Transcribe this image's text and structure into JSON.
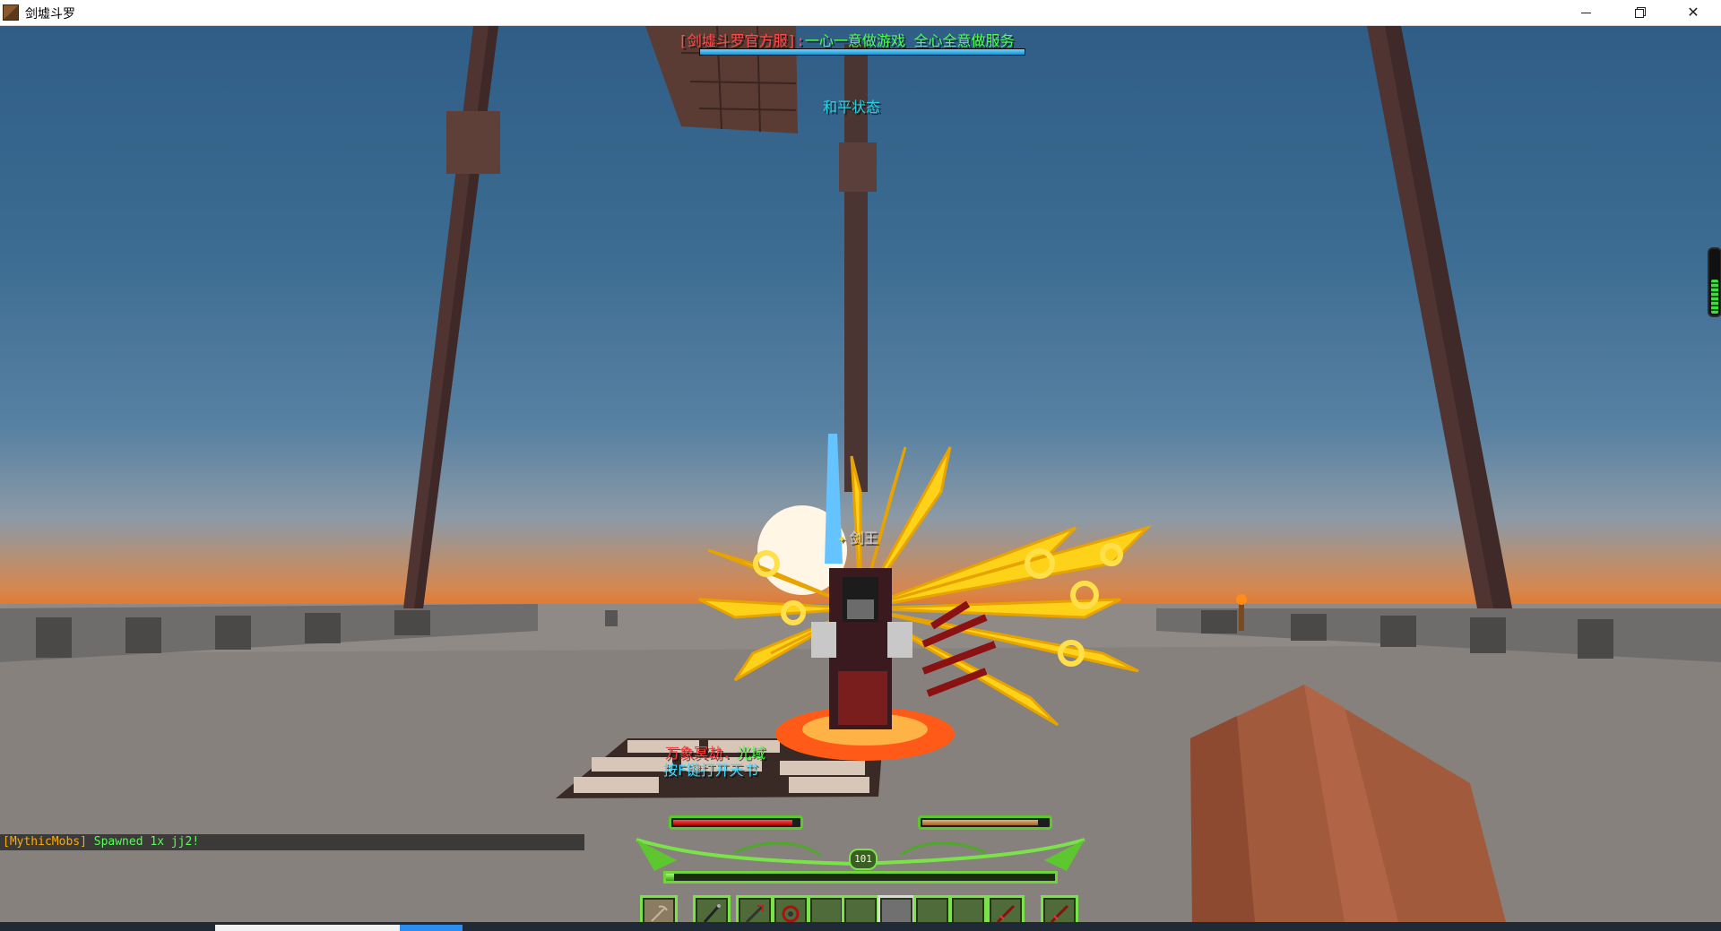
{
  "window": {
    "title": "剑墟斗罗",
    "icon": "minecraft-block-icon",
    "controls": [
      "minimize",
      "maximize",
      "close"
    ],
    "close_glyph": "✕"
  },
  "hud": {
    "boss_title_server": "[剑墟斗罗官方服]:",
    "boss_title_slogan": "一心一意做游戏 全心全意做服务",
    "boss_bar_fill": 1.0,
    "state_label": "和平状态",
    "player_name_tag": "剑王",
    "subtitle_red": "万象冥劫.",
    "subtitle_green": "光域",
    "subtitle_cyan": "按F键打开天书",
    "health_fill": 0.95,
    "hunger_fill": 0.92,
    "level": "101",
    "xp_fill": 0.02,
    "edge_meter_fill": 0.55
  },
  "hotbar": {
    "offhand_item": "pickaxe-icon",
    "selected_index": 6,
    "slots": [
      "staff-icon",
      "spear-icon",
      "bow-icon",
      "",
      "",
      "",
      "",
      "",
      "red-sword-icon"
    ],
    "extra_item": "red-sword-icon"
  },
  "chat": {
    "lines": [
      {
        "tag": "[MythicMobs]",
        "message": " Spawned 1x jj2!"
      }
    ]
  },
  "colors": {
    "frame_green": "#7be34a",
    "health_red": "#d10000",
    "server_red": "#ff4b4b",
    "slogan_green": "#4cff4c",
    "state_cyan": "#1fd3e5"
  }
}
